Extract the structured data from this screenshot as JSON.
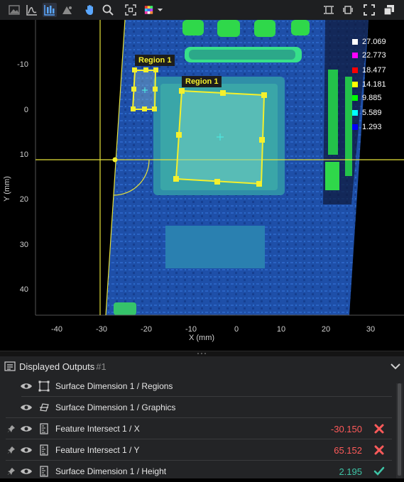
{
  "toolbar": {
    "left_icons": [
      "image-icon",
      "profile-icon",
      "bar-chart-icon",
      "point-cloud-icon",
      "hand-pan-icon",
      "zoom-icon",
      "fit-view-icon",
      "color-map-icon"
    ],
    "right_icons": [
      "layout-1-icon",
      "layout-2-icon",
      "fullscreen-icon",
      "window-icon"
    ]
  },
  "viewer": {
    "x_axis_label": "X (mm)",
    "y_axis_label": "Y (mm)",
    "y_ticks": [
      "-10",
      "0",
      "10",
      "20",
      "30",
      "40"
    ],
    "x_ticks": [
      "-40",
      "-30",
      "-20",
      "-10",
      "0",
      "10",
      "20",
      "30"
    ],
    "region_labels": [
      "Region 1",
      "Region 1"
    ],
    "legend": [
      {
        "value": "27.069",
        "color": "#ffffff"
      },
      {
        "value": "22.773",
        "color": "#ff00ff"
      },
      {
        "value": "18.477",
        "color": "#ff0000"
      },
      {
        "value": "14.181",
        "color": "#ffff00"
      },
      {
        "value": "9.885",
        "color": "#00ff00"
      },
      {
        "value": "5.589",
        "color": "#00ffff"
      },
      {
        "value": "1.293",
        "color": "#0000ff"
      }
    ]
  },
  "panel": {
    "title": "Displayed Outputs",
    "count": "#1",
    "rows": [
      {
        "label": "Surface Dimension 1 / Regions",
        "value": "",
        "status": "",
        "pinned": false
      },
      {
        "label": "Surface Dimension 1 / Graphics",
        "value": "",
        "status": "",
        "pinned": false
      },
      {
        "label": "Feature Intersect 1 / X",
        "value": "-30.150",
        "status": "fail",
        "pinned": true
      },
      {
        "label": "Feature Intersect 1 / Y",
        "value": "65.152",
        "status": "fail",
        "pinned": true
      },
      {
        "label": "Surface Dimension 1 / Height",
        "value": "2.195",
        "status": "pass",
        "pinned": true
      }
    ]
  },
  "colors": {
    "fail": "#ff5a5a",
    "pass": "#3ec4a6",
    "region": "#f4f02c",
    "crosshair": "#e6e23a"
  }
}
